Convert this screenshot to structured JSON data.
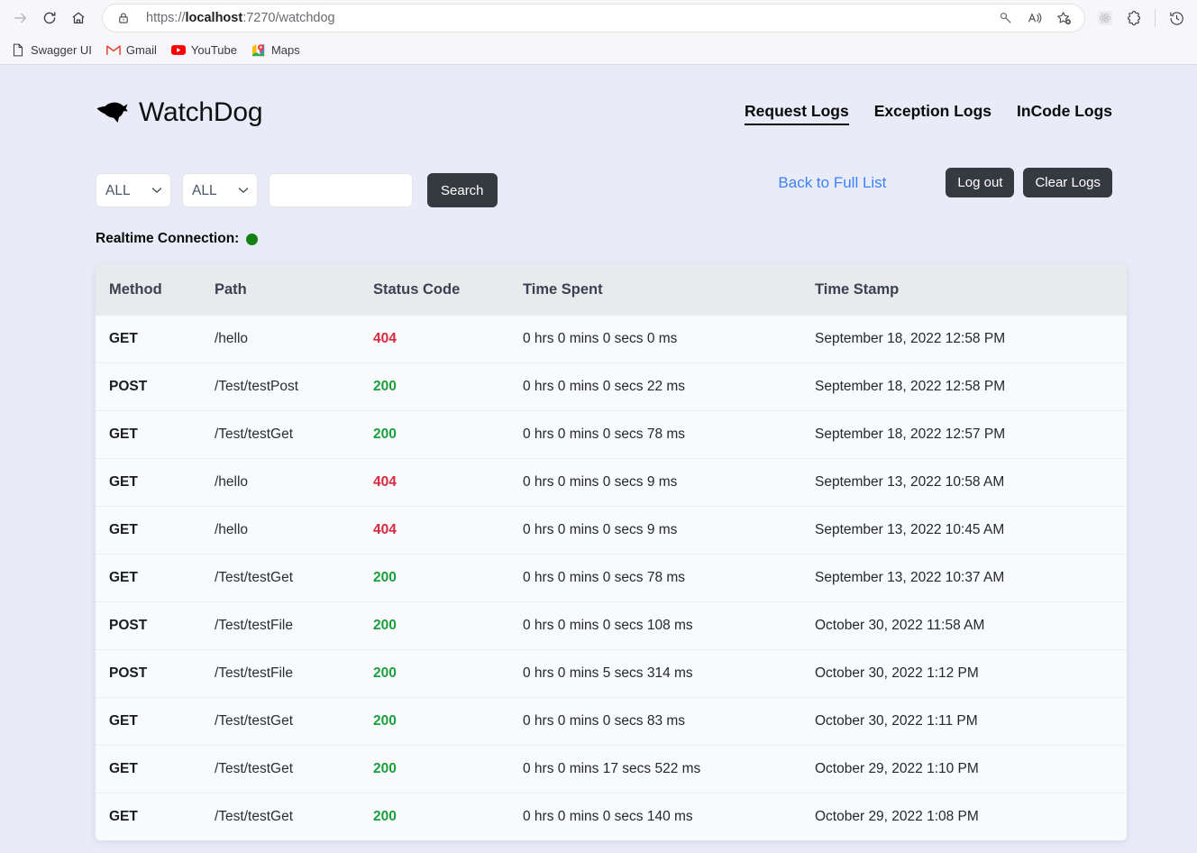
{
  "browser": {
    "url_prefix": "https://",
    "url_host": "localhost",
    "url_suffix": ":7270/watchdog",
    "url_full": "https://localhost:7270/watchdog",
    "nav": {
      "forward": "forward-arrow",
      "refresh": "refresh",
      "home": "home"
    },
    "bookmarks": [
      {
        "label": "Swagger UI",
        "icon": "document-icon"
      },
      {
        "label": "Gmail",
        "icon": "gmail-icon"
      },
      {
        "label": "YouTube",
        "icon": "youtube-icon"
      },
      {
        "label": "Maps",
        "icon": "maps-icon"
      }
    ],
    "toolbar_icons": [
      "key-icon",
      "read-aloud-icon",
      "add-favorite-icon",
      "react-devtools-icon",
      "extensions-icon",
      "history-icon"
    ]
  },
  "app": {
    "brand": "WatchDog",
    "tabs": [
      {
        "label": "Request Logs",
        "active": true
      },
      {
        "label": "Exception Logs",
        "active": false
      },
      {
        "label": "InCode Logs",
        "active": false
      }
    ],
    "filters": {
      "method_select": "ALL",
      "status_select": "ALL",
      "search_value": "",
      "search_placeholder": "",
      "search_button": "Search"
    },
    "actions": {
      "back_link": "Back to Full List",
      "logout_button": "Log out",
      "clear_logs_button": "Clear Logs"
    },
    "realtime": {
      "label": "Realtime Connection:",
      "status_color": "#128012"
    },
    "colors": {
      "page_background": "#e9ecf8",
      "accent_link": "#3b82f6",
      "button_dark": "#343a40",
      "status_ok": "#1a9e3e",
      "status_error": "#d6293e"
    }
  },
  "table": {
    "columns": [
      "Method",
      "Path",
      "Status Code",
      "Time Spent",
      "Time Stamp"
    ],
    "rows": [
      {
        "method": "GET",
        "path": "/hello",
        "status": "404",
        "time_spent": "0 hrs 0 mins 0 secs 0 ms",
        "timestamp": "September 18, 2022 12:58 PM"
      },
      {
        "method": "POST",
        "path": "/Test/testPost",
        "status": "200",
        "time_spent": "0 hrs 0 mins 0 secs 22 ms",
        "timestamp": "September 18, 2022 12:58 PM"
      },
      {
        "method": "GET",
        "path": "/Test/testGet",
        "status": "200",
        "time_spent": "0 hrs 0 mins 0 secs 78 ms",
        "timestamp": "September 18, 2022 12:57 PM"
      },
      {
        "method": "GET",
        "path": "/hello",
        "status": "404",
        "time_spent": "0 hrs 0 mins 0 secs 9 ms",
        "timestamp": "September 13, 2022 10:58 AM"
      },
      {
        "method": "GET",
        "path": "/hello",
        "status": "404",
        "time_spent": "0 hrs 0 mins 0 secs 9 ms",
        "timestamp": "September 13, 2022 10:45 AM"
      },
      {
        "method": "GET",
        "path": "/Test/testGet",
        "status": "200",
        "time_spent": "0 hrs 0 mins 0 secs 78 ms",
        "timestamp": "September 13, 2022 10:37 AM"
      },
      {
        "method": "POST",
        "path": "/Test/testFile",
        "status": "200",
        "time_spent": "0 hrs 0 mins 0 secs 108 ms",
        "timestamp": "October 30, 2022 11:58 AM"
      },
      {
        "method": "POST",
        "path": "/Test/testFile",
        "status": "200",
        "time_spent": "0 hrs 0 mins 5 secs 314 ms",
        "timestamp": "October 30, 2022 1:12 PM"
      },
      {
        "method": "GET",
        "path": "/Test/testGet",
        "status": "200",
        "time_spent": "0 hrs 0 mins 0 secs 83 ms",
        "timestamp": "October 30, 2022 1:11 PM"
      },
      {
        "method": "GET",
        "path": "/Test/testGet",
        "status": "200",
        "time_spent": "0 hrs 0 mins 17 secs 522 ms",
        "timestamp": "October 29, 2022 1:10 PM"
      },
      {
        "method": "GET",
        "path": "/Test/testGet",
        "status": "200",
        "time_spent": "0 hrs 0 mins 0 secs 140 ms",
        "timestamp": "October 29, 2022 1:08 PM"
      }
    ]
  }
}
